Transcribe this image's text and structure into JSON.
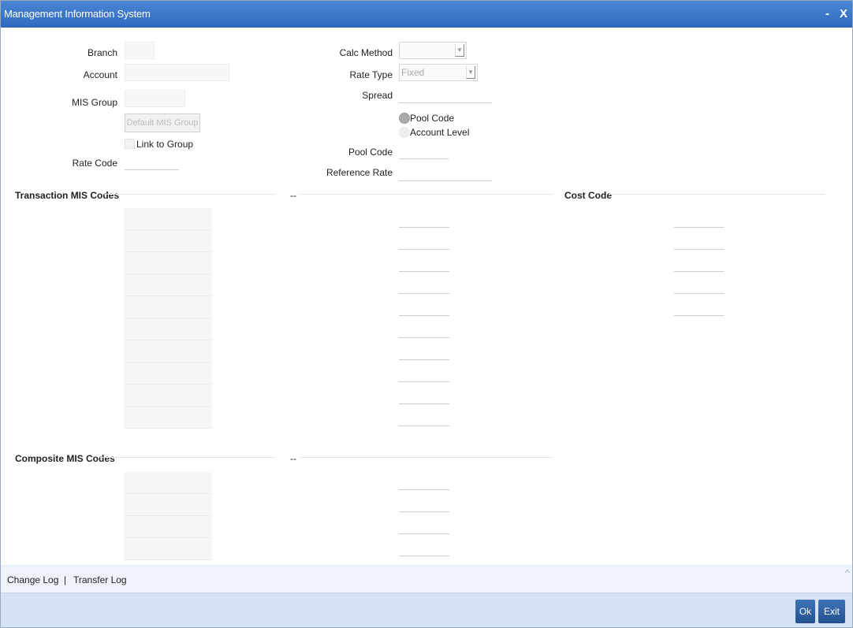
{
  "window": {
    "title": "Management Information System",
    "minimize": "-",
    "close": "X"
  },
  "form": {
    "branch_label": "Branch",
    "account_label": "Account",
    "mis_group_label": "MIS Group",
    "default_mis_group_button": "Default MIS Group",
    "link_to_group_label": "Link to Group",
    "rate_code_label": "Rate Code",
    "calc_method_label": "Calc Method",
    "calc_method_value": "",
    "rate_type_label": "Rate Type",
    "rate_type_value": "Fixed",
    "spread_label": "Spread",
    "pool_code_option": "Pool Code",
    "account_level_option": "Account Level",
    "pool_code_label": "Pool Code",
    "reference_rate_label": "Reference Rate"
  },
  "sections": {
    "transaction_mis_codes": "Transaction MIS Codes",
    "transaction_mid": "--",
    "cost_code": "Cost Code",
    "composite_mis_codes": "Composite MIS Codes",
    "composite_mid": "--"
  },
  "footer": {
    "change_log": "Change Log",
    "separator": "|",
    "transfer_log": "Transfer Log",
    "collapse_icon": "^",
    "ok_button": "Ok",
    "exit_button": "Exit"
  },
  "colors": {
    "title_bar": "#3a76c8",
    "footer_band": "#d6e3f6",
    "button": "#2f62a5"
  }
}
